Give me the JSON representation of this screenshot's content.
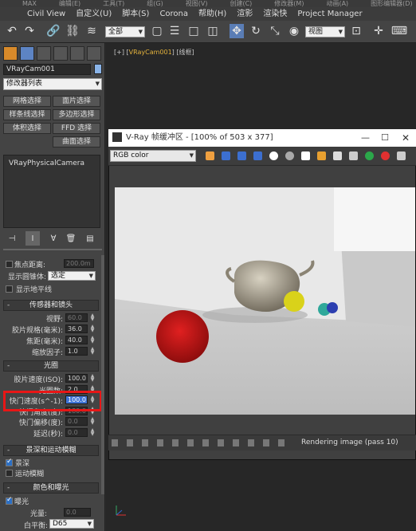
{
  "menubar_top": [
    "MAX",
    "编辑(E)",
    "工具(T)",
    "组(G)",
    "视图(V)",
    "创建(C)",
    "修改器(M)",
    "动画(A)",
    "图形编辑器(D)",
    "渲染(R)"
  ],
  "menubar": [
    "Civil View",
    "自定义(U)",
    "脚本(S)",
    "Corona",
    "帮助(H)",
    "渲影",
    "渲染快",
    "Project Manager"
  ],
  "toolbar": {
    "selection_filter": "全部",
    "view_dropdown": "视图"
  },
  "command_panel": {
    "object_name": "VRayCam001",
    "modifier_list": "修改器列表",
    "buttons": [
      "网格选择",
      "面片选择",
      "样条线选择",
      "多边形选择",
      "体积选择",
      "FFD 选择",
      "",
      "曲面选择"
    ],
    "stack_item": "VRayPhysicalCamera",
    "focus": {
      "label": "焦点距离:",
      "value": "200.0m"
    },
    "show_cone": {
      "label": "显示圆锥体:",
      "value": "选定"
    },
    "show_horizon": "显示地平线",
    "sections": {
      "sensor": "传感器和镜头",
      "aperture": "光圈",
      "dof": "景深和运动模糊",
      "color": "颜色和曝光"
    },
    "sensor_rows": [
      {
        "label": "视野:",
        "value": "60.0",
        "disabled": true
      },
      {
        "label": "胶片规格(毫米):",
        "value": "36.0"
      },
      {
        "label": "焦距(毫米):",
        "value": "40.0"
      },
      {
        "label": "缩放因子:",
        "value": "1.0"
      }
    ],
    "aperture_rows": [
      {
        "label": "胶片速度(ISO):",
        "value": "100.0"
      },
      {
        "label": "光圈数:",
        "value": "2.0"
      },
      {
        "label": "快门速度(s^-1):",
        "value": "100.0",
        "highlight": true
      },
      {
        "label": "快门角度(度):",
        "value": "180.0",
        "disabled": true
      },
      {
        "label": "快门偏移(度):",
        "value": "0.0",
        "disabled": true
      },
      {
        "label": "延迟(秒):",
        "value": "0.0",
        "disabled": true
      }
    ],
    "dof_checks": [
      {
        "label": "景深",
        "checked": true
      },
      {
        "label": "运动模糊",
        "checked": false
      }
    ],
    "exposure_check": {
      "label": "曝光",
      "checked": true
    },
    "light_value": {
      "label": "光量:",
      "value": "0.0"
    },
    "white_balance": {
      "label": "白平衡:",
      "value": "D65"
    }
  },
  "viewport": {
    "label_prefix": "[+] [",
    "camera": "VRayCam001",
    "label_suffix": "] [线框]"
  },
  "vray": {
    "title": "V-Ray 帧缓冲区 - [100% of 503 x 377]",
    "channel": "RGB color",
    "status": "Rendering image (pass 10)"
  },
  "colors": {
    "highlight": "#e81616",
    "camera_label": "#e3b23c",
    "checkbox_blue": "#2b6fc4"
  }
}
